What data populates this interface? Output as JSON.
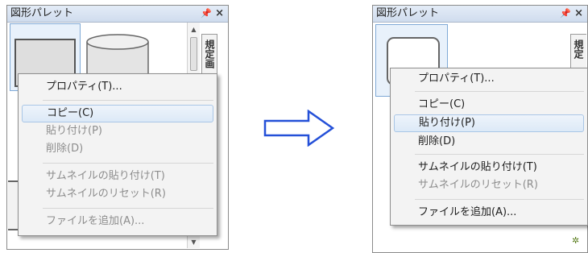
{
  "left_panel": {
    "title": "図形パレット",
    "pin_icon": "pin-icon",
    "close_icon": "close-icon",
    "side_tab_label": "規定画",
    "context_menu": {
      "items": [
        {
          "label": "プロパティ(T)...",
          "enabled": true,
          "highlighted": false
        },
        {
          "label": "コピー(C)",
          "enabled": true,
          "highlighted": true
        },
        {
          "label": "貼り付け(P)",
          "enabled": false,
          "highlighted": false
        },
        {
          "label": "削除(D)",
          "enabled": false,
          "highlighted": false
        },
        {
          "label": "サムネイルの貼り付け(T)",
          "enabled": false,
          "highlighted": false
        },
        {
          "label": "サムネイルのリセット(R)",
          "enabled": false,
          "highlighted": false
        },
        {
          "label": "ファイルを追加(A)...",
          "enabled": false,
          "highlighted": false
        }
      ]
    }
  },
  "right_panel": {
    "title": "図形パレット",
    "pin_icon": "pin-icon",
    "close_icon": "close-icon",
    "side_tab_label": "規定",
    "context_menu": {
      "items": [
        {
          "label": "プロパティ(T)...",
          "enabled": true,
          "highlighted": false
        },
        {
          "label": "コピー(C)",
          "enabled": true,
          "highlighted": false
        },
        {
          "label": "貼り付け(P)",
          "enabled": true,
          "highlighted": true
        },
        {
          "label": "削除(D)",
          "enabled": true,
          "highlighted": false
        },
        {
          "label": "サムネイルの貼り付け(T)",
          "enabled": true,
          "highlighted": false
        },
        {
          "label": "サムネイルのリセット(R)",
          "enabled": false,
          "highlighted": false
        },
        {
          "label": "ファイルを追加(A)...",
          "enabled": true,
          "highlighted": false
        }
      ]
    }
  },
  "transition_arrow_icon": "right-arrow-icon",
  "colors": {
    "title_bar": "#cfdcee",
    "highlight_border": "#a9c6e6",
    "arrow": "#2450d8",
    "menu_background": "#f3f3f3",
    "disabled_text": "#8d8d8d"
  }
}
